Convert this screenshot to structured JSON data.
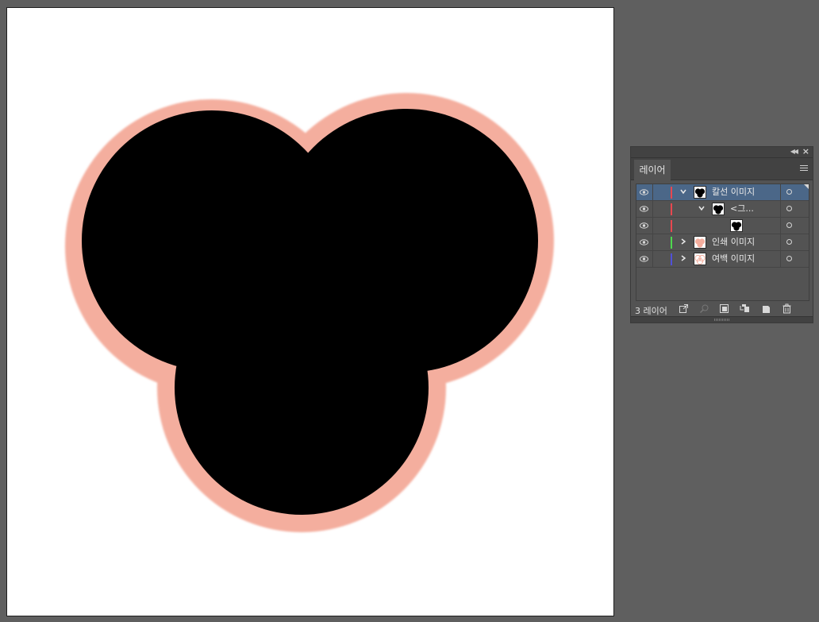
{
  "app": {
    "panel_tab_label": "레이어",
    "layer_count_label": "3 레이어"
  },
  "layers": [
    {
      "label": "칼선 이미지",
      "color": "#e8474f",
      "selected": true,
      "expanded": true,
      "level": 0
    },
    {
      "label": "<그...",
      "color": "#e8474f",
      "selected": false,
      "expanded": true,
      "level": 1
    },
    {
      "label": "",
      "color": "#e8474f",
      "selected": false,
      "level": 2
    },
    {
      "label": "인쇄 이미지",
      "color": "#4ed84e",
      "selected": false,
      "expanded": false,
      "level": 0
    },
    {
      "label": "여백 이미지",
      "color": "#5050d8",
      "selected": false,
      "expanded": false,
      "level": 0
    }
  ],
  "colors": {
    "canvas_bg": "#5f5f5f",
    "artboard_bg": "#ffffff",
    "shape_fill": "#000000",
    "shape_outline": "#f4ae9e",
    "panel_bg": "#535353",
    "selected_row": "#4b6788"
  },
  "icons": {
    "top_right": [
      "collapse-panel-icon",
      "close-icon"
    ],
    "tab_menu": "panel-menu-icon",
    "bottom_toolbar": [
      "export-icon",
      "search-icon",
      "clip-mask-icon",
      "sublayer-icon",
      "new-layer-icon",
      "trash-icon"
    ]
  }
}
